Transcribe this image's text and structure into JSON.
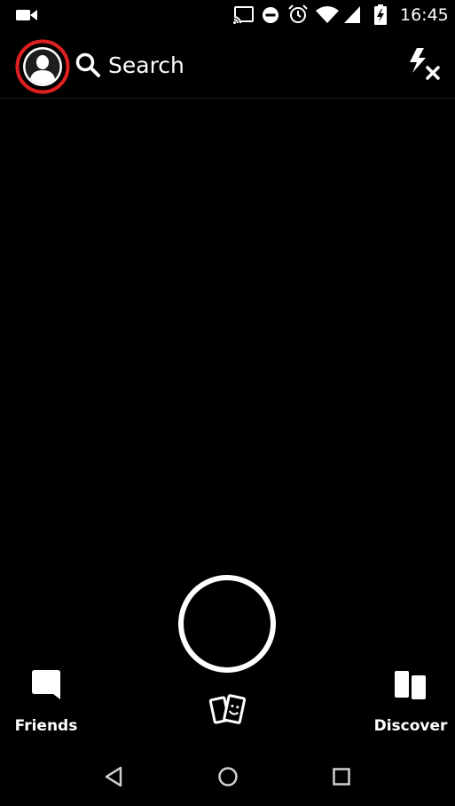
{
  "status_bar": {
    "time": "16:45",
    "icons": [
      "video-camera-icon",
      "cast-icon",
      "do-not-disturb-icon",
      "alarm-icon",
      "wifi-icon",
      "cell-signal-icon",
      "battery-charging-icon"
    ]
  },
  "header": {
    "avatar_icon": "profile-avatar-icon",
    "search_label": "Search",
    "flash_icon": "flash-off-icon",
    "avatar_highlight_color": "#e02020"
  },
  "camera": {
    "shutter_icon": "shutter-button",
    "memories_icon": "memories-icon"
  },
  "bottom_nav": {
    "friends_label": "Friends",
    "discover_label": "Discover"
  },
  "android_nav": {
    "keys": [
      "back-icon",
      "home-icon",
      "recents-icon"
    ]
  }
}
